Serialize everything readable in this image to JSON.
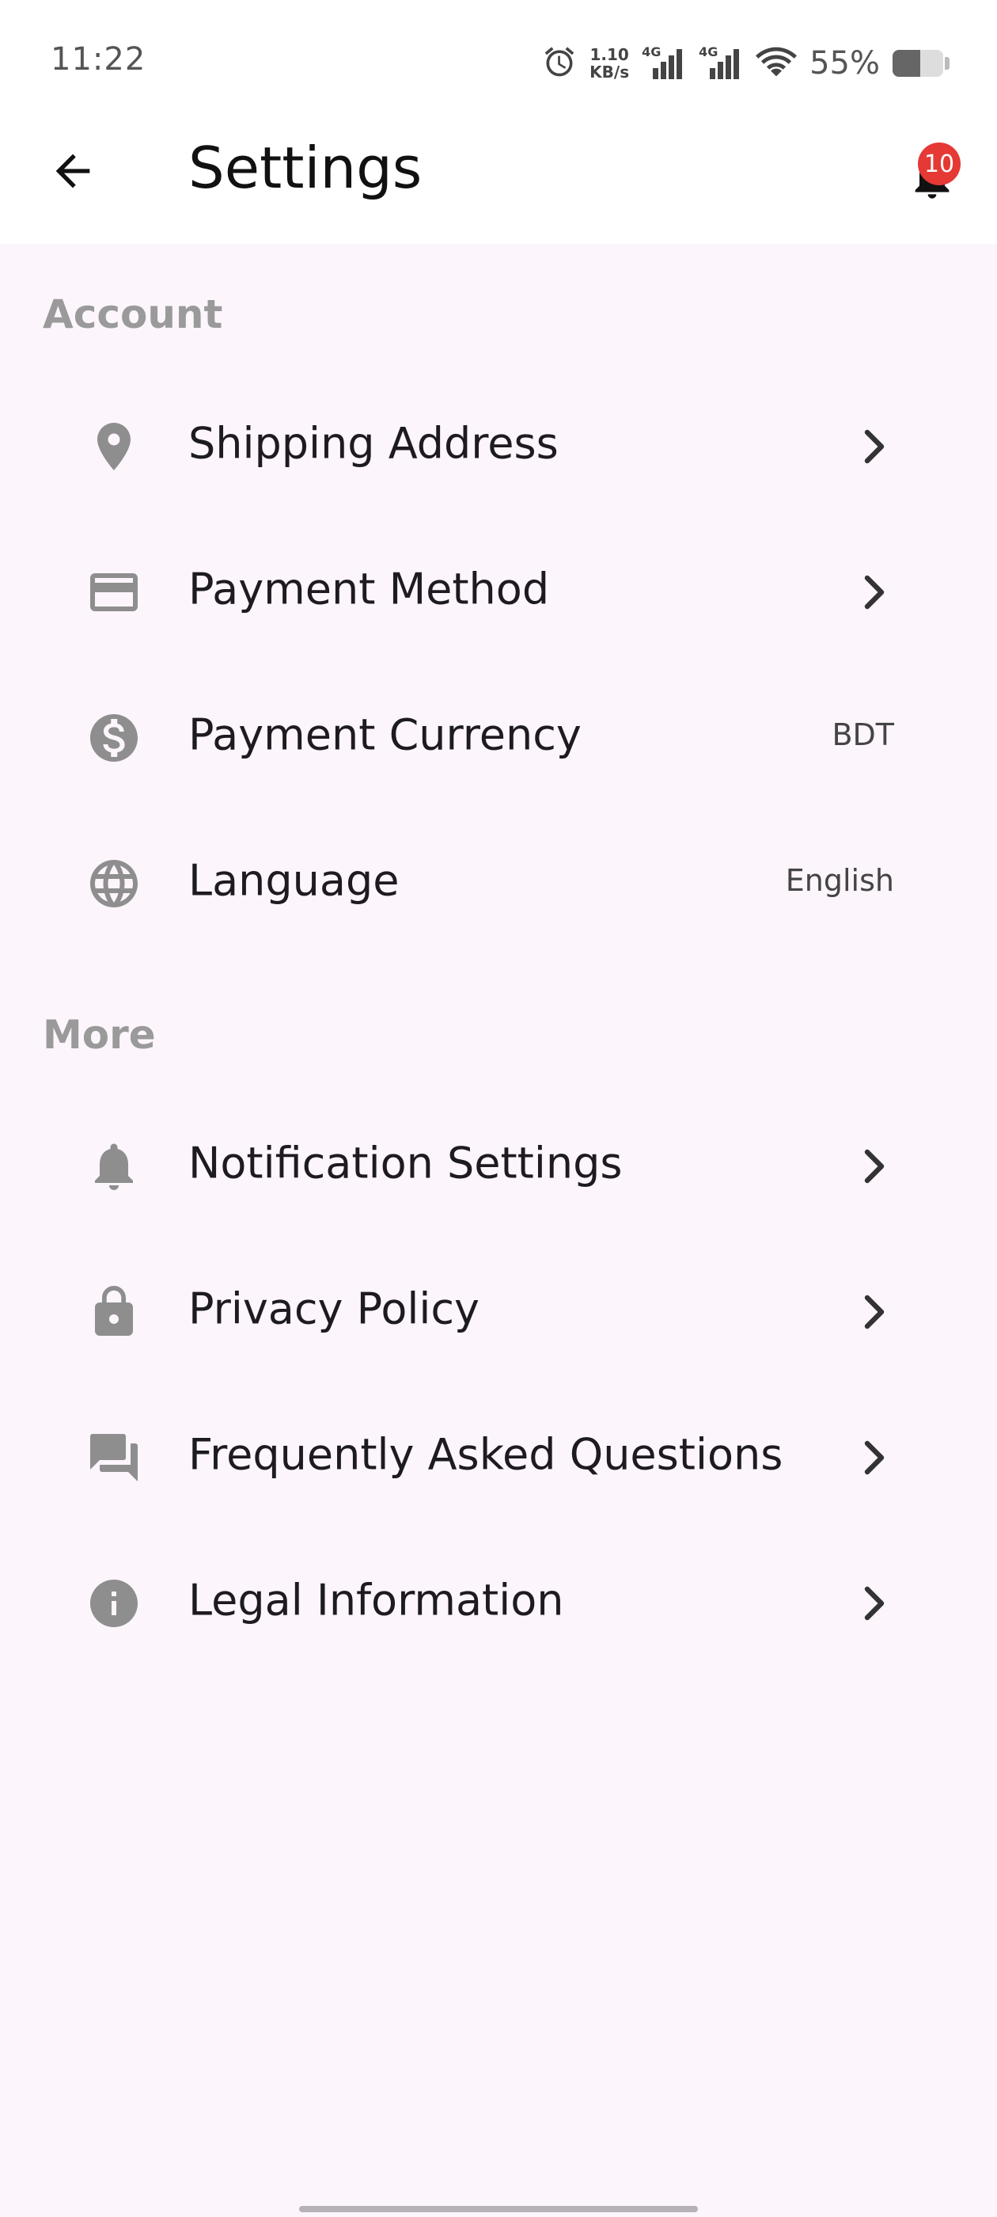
{
  "status_bar": {
    "time": "11:22",
    "net_speed_value": "1.10",
    "net_speed_unit": "KB/s",
    "network_type_1": "4G",
    "network_type_2": "4G",
    "battery_percent": "55%",
    "battery_level": 0.55,
    "icons": [
      "alarm-icon",
      "signal-icon",
      "signal-icon",
      "wifi-icon",
      "battery-icon"
    ]
  },
  "app_bar": {
    "title": "Settings",
    "back_icon": "arrow-back-icon",
    "notifications_icon": "bell-icon",
    "notification_count": "10",
    "badge_color": "#e53935"
  },
  "sections": [
    {
      "title": "Account",
      "items": [
        {
          "label": "Shipping Address",
          "icon": "location-pin-icon",
          "trailing": "chevron"
        },
        {
          "label": "Payment Method",
          "icon": "credit-card-icon",
          "trailing": "chevron"
        },
        {
          "label": "Payment Currency",
          "icon": "dollar-icon",
          "value": "BDT"
        },
        {
          "label": "Language",
          "icon": "globe-icon",
          "value": "English"
        }
      ]
    },
    {
      "title": "More",
      "items": [
        {
          "label": "Notification Settings",
          "icon": "bell-icon",
          "trailing": "chevron"
        },
        {
          "label": "Privacy Policy",
          "icon": "lock-icon",
          "trailing": "chevron"
        },
        {
          "label": "Frequently Asked Questions",
          "icon": "chat-icon",
          "trailing": "chevron"
        },
        {
          "label": "Legal Information",
          "icon": "info-icon",
          "trailing": "chevron"
        }
      ]
    }
  ],
  "colors": {
    "background": "#fcf5fc",
    "section_title": "#9a9a9a",
    "icon": "#8e8e8e",
    "badge": "#e53935"
  }
}
